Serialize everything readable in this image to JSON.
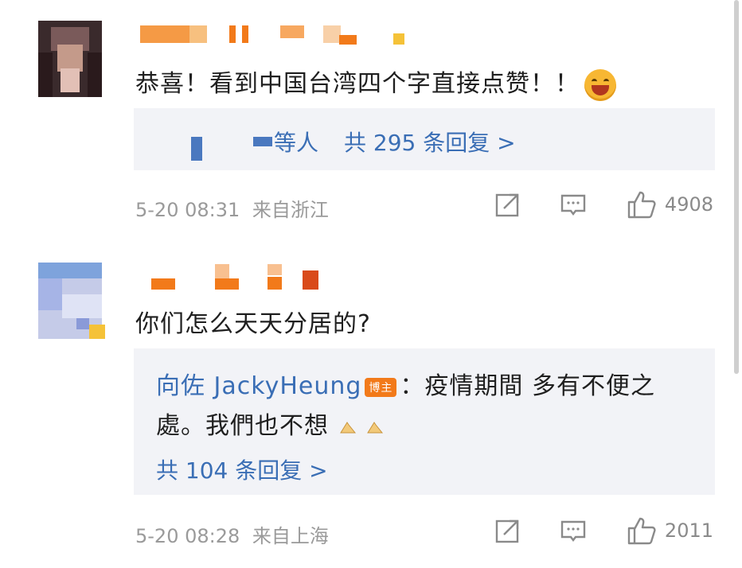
{
  "comments": [
    {
      "text": "恭喜！看到中国台湾四个字直接点赞！！",
      "emoji": "laughing-face",
      "reply_preview_names": "等人",
      "reply_count": "共 295 条回复 >",
      "time": "5-20 08:31",
      "location": "来自浙江",
      "likes": "4908"
    },
    {
      "text": "你们怎么天天分居的?",
      "reply_author": "向佐 JackyHeung",
      "reply_badge": "博主",
      "reply_line1": "：疫情期間 多有不便之",
      "reply_line2": "處。我們也不想",
      "reply_count": "共 104 条回复 >",
      "time": "5-20 08:28",
      "location": "来自上海",
      "likes": "2011"
    }
  ],
  "colors": {
    "link": "#3a6eb5",
    "meta": "#9a9a9a",
    "reply_bg": "#f2f3f7",
    "badge": "#f27a1a"
  }
}
